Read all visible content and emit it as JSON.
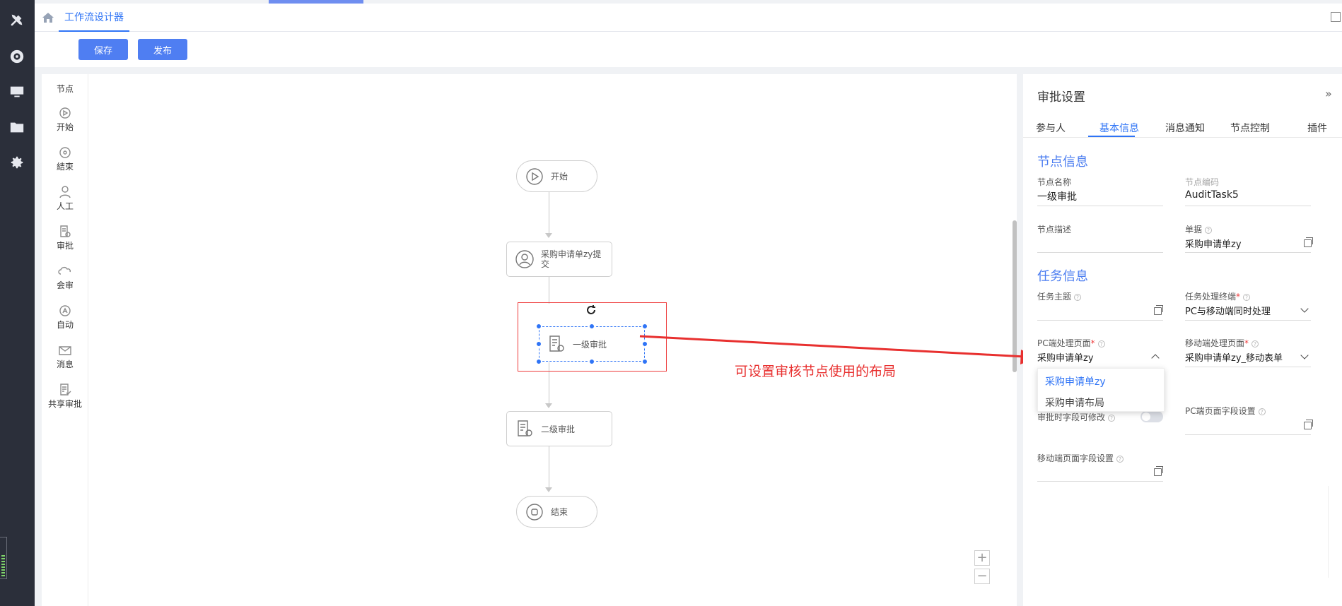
{
  "leftbar": {
    "icons": [
      "tools-icon",
      "dashboard-icon",
      "monitor-icon",
      "folder-icon",
      "gear-icon"
    ]
  },
  "tabbar": {
    "active_tab": "工作流设计器"
  },
  "toolbar": {
    "save_label": "保存",
    "publish_label": "发布"
  },
  "palette": {
    "title": "节点",
    "items": [
      {
        "label": "开始",
        "icon": "play-circle-icon"
      },
      {
        "label": "結束",
        "icon": "stop-circle-icon"
      },
      {
        "label": "人工",
        "icon": "user-icon"
      },
      {
        "label": "审批",
        "icon": "approval-doc-icon"
      },
      {
        "label": "会审",
        "icon": "cloud-icon"
      },
      {
        "label": "自动",
        "icon": "auto-icon"
      },
      {
        "label": "消息",
        "icon": "mail-icon"
      },
      {
        "label": "共享审批",
        "icon": "shared-approval-icon"
      }
    ]
  },
  "flow": {
    "start": "开始",
    "submit": "采购申请单zy提交",
    "level1": "一级审批",
    "level2": "二级审批",
    "end": "结束"
  },
  "annotation": "可设置审核节点使用的布局",
  "panel": {
    "title": "审批设置",
    "tabs": [
      "参与人",
      "基本信息",
      "消息通知",
      "节点控制",
      "插件"
    ],
    "node_section": "节点信息",
    "node_name_label": "节点名称",
    "node_name_value": "一级审批",
    "node_code_label": "节点编码",
    "node_code_value": "AuditTask5",
    "node_desc_label": "节点描述",
    "form_label": "单据",
    "form_value": "采购申请单zy",
    "task_section": "任务信息",
    "task_subject_label": "任务主题",
    "terminal_label": "任务处理终端",
    "terminal_value": "PC与移动端同时处理",
    "pc_page_label": "PC端处理页面",
    "pc_page_value": "采购申请单zy",
    "mobile_page_label": "移动端处理页面",
    "mobile_page_value": "采购申请单zy_移动表单",
    "editable_label": "审批时字段可修改",
    "pc_field_label": "PC端页面字段设置",
    "mobile_field_label": "移动端页面字段设置",
    "dropdown_options": [
      "采购申请单zy",
      "采购申请布局"
    ]
  },
  "colors": {
    "accent": "#2f74f6",
    "button": "#4f7ef2",
    "annotation": "#e8302f",
    "sidebar": "#2b2f3a"
  }
}
